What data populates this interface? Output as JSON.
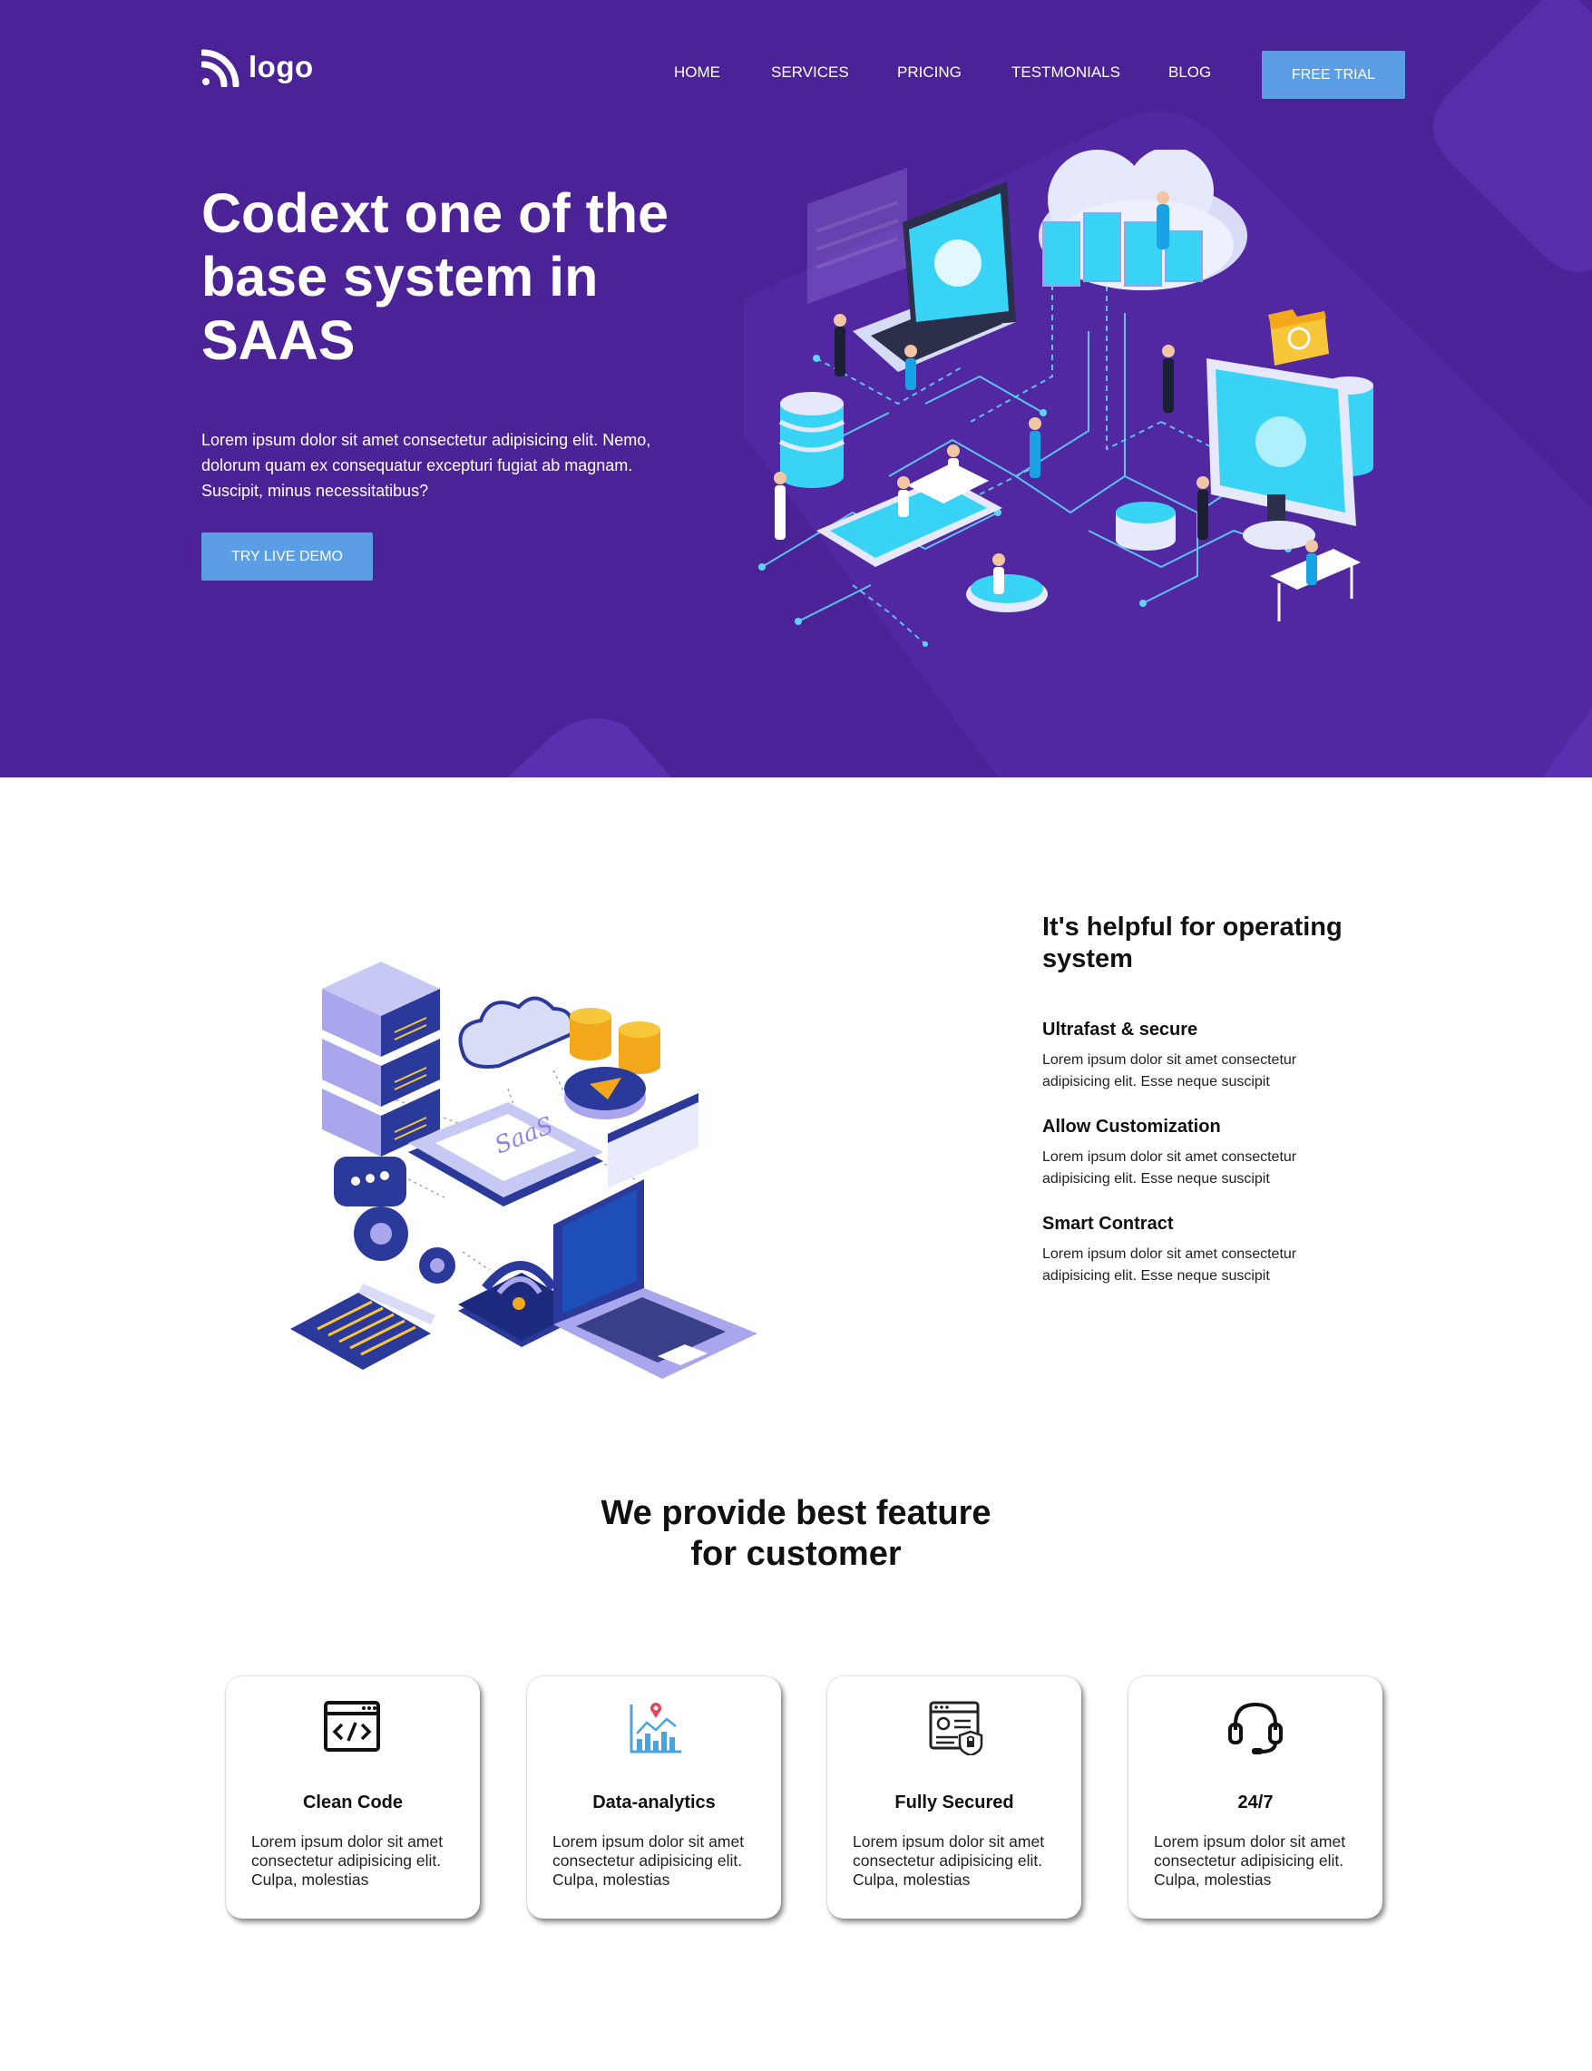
{
  "header": {
    "logo_text": "logo",
    "nav": [
      "HOME",
      "SERVICES",
      "PRICING",
      "TESTMONIALS",
      "BLOG"
    ],
    "cta_label": "FREE TRIAL"
  },
  "hero": {
    "title": "Codext one of the base system in SAAS",
    "description": "Lorem ipsum dolor sit amet consectetur adipisicing elit. Nemo, dolorum quam ex consequatur excepturi fugiat ab magnam. Suscipit, minus necessitatibus?",
    "demo_label": "TRY LIVE DEMO"
  },
  "operating": {
    "title": "It's helpful for operating system",
    "illustration_label": "SaaS",
    "features": [
      {
        "title": "Ultrafast & secure",
        "desc": "Lorem ipsum dolor sit amet consectetur adipisicing elit. Esse neque suscipit"
      },
      {
        "title": "Allow Customization",
        "desc": "Lorem ipsum dolor sit amet consectetur adipisicing elit. Esse neque suscipit"
      },
      {
        "title": "Smart Contract",
        "desc": "Lorem ipsum dolor sit amet consectetur adipisicing elit. Esse neque suscipit"
      }
    ]
  },
  "features_section": {
    "title": "We provide best feature for customer",
    "cards": [
      {
        "icon": "code-window-icon",
        "title": "Clean Code",
        "desc": "Lorem ipsum dolor sit amet consectetur adipisicing elit. Culpa, molestias"
      },
      {
        "icon": "analytics-chart-icon",
        "title": "Data-analytics",
        "desc": "Lorem ipsum dolor sit amet consectetur adipisicing elit. Culpa, molestias"
      },
      {
        "icon": "security-shield-icon",
        "title": "Fully Secured",
        "desc": "Lorem ipsum dolor sit amet consectetur adipisicing elit. Culpa, molestias"
      },
      {
        "icon": "headset-icon",
        "title": "24/7",
        "desc": "Lorem ipsum dolor sit amet consectetur adipisicing elit. Culpa, molestias"
      }
    ]
  },
  "colors": {
    "hero_bg": "#4a2394",
    "accent_button": "#5b9ee6"
  }
}
